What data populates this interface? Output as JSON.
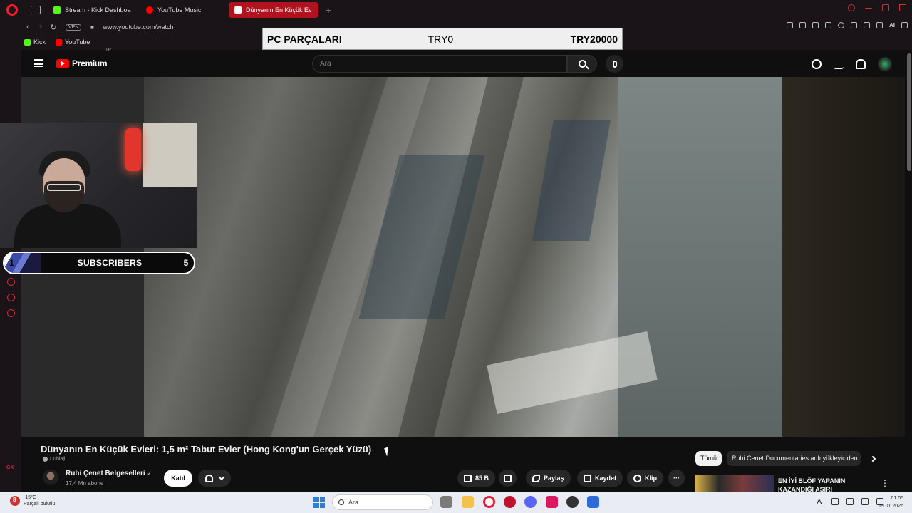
{
  "browser": {
    "tabs": [
      {
        "label": "",
        "favicon_color": "#888888"
      },
      {
        "label": "Stream - Kick Dashboa",
        "favicon_color": "#53fc18"
      },
      {
        "label": "YouTube Music",
        "favicon_color": "#ff0000"
      },
      {
        "label": "Dünyanın En Küçük Ev",
        "favicon_color": "#ffffff",
        "active": true
      }
    ],
    "new_tab": "+",
    "vpn_label": "VPN",
    "url": "www.youtube.com/watch",
    "ai_label": "AI",
    "bookmarks": [
      {
        "label": "Kick",
        "favicon_color": "#53fc18"
      },
      {
        "label": "YouTube",
        "favicon_color": "#ff0000"
      }
    ],
    "sidebar_label": "GX",
    "accent_color": "#d2283a"
  },
  "youtube": {
    "logo_text": "Premium",
    "region": "TR",
    "search_placeholder": "Ara",
    "video_title": "Dünyanın En Küçük Evleri: 1,5 m² Tabut Evler (Hong Kong'un Gerçek Yüzü)",
    "dubbed_label": "Dublajlı",
    "channel_name": "Ruhi Çenet Belgeselleri",
    "channel_verified": "✓",
    "subscribers": "17,4 Mn abone",
    "join_label": "Katıl",
    "like_count": "85 B",
    "actions": {
      "share": "Paylaş",
      "save": "Kaydet",
      "clip": "Klip",
      "more": "···"
    },
    "chips": {
      "all": "Tümü",
      "channel": "Ruhi Cenet Documentaries adlı yükleyiciden"
    },
    "recommended": {
      "title": "EN İYİ BLÖF YAPANIN KAZANDIĞI AŞIRI EĞLENCELİ",
      "menu": "⋮"
    }
  },
  "stream_overlay": {
    "title": "PC PARÇALARI",
    "min_value": "TRY0",
    "max_value": "TRY20000",
    "subscriber_goal": {
      "current": "1",
      "label": "SUBSCRIBERS",
      "target": "5"
    }
  },
  "taskbar": {
    "weather_temp": "-15°C",
    "weather_desc": "Parçalı bulutlu",
    "weather_badge": "8",
    "search_placeholder": "Ara",
    "time": "01:05",
    "date": "19.01.2026",
    "app_colors": [
      "#e7e7e7",
      "#7a7a7a",
      "#f2c14e",
      "#e0243b",
      "#c0142c",
      "#5865f2",
      "#d81b60",
      "#333333",
      "#2e6bd6"
    ]
  }
}
